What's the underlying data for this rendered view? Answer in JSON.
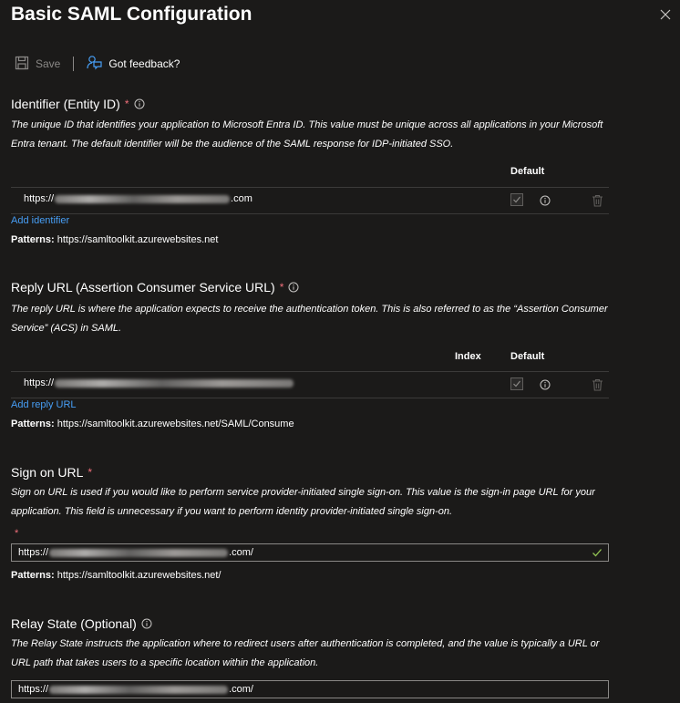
{
  "header": {
    "title": "Basic SAML Configuration"
  },
  "toolbar": {
    "save_label": "Save",
    "feedback_label": "Got feedback?"
  },
  "identifier": {
    "title": "Identifier (Entity ID)",
    "required_marker": "*",
    "description": "The unique ID that identifies your application to Microsoft Entra ID. This value must be unique across all applications in your Microsoft Entra tenant. The default identifier will be the audience of the SAML response for IDP-initiated SSO.",
    "col_default": "Default",
    "rows": [
      {
        "url_prefix": "https://",
        "url_suffix": ".com",
        "default_checked": true
      }
    ],
    "add_link": "Add identifier",
    "patterns_label": "Patterns:",
    "patterns_value": " https://samltoolkit.azurewebsites.net"
  },
  "reply_url": {
    "title": "Reply URL (Assertion Consumer Service URL)",
    "required_marker": "*",
    "description": "The reply URL is where the application expects to receive the authentication token. This is also referred to as the “Assertion Consumer Service” (ACS) in SAML.",
    "col_index": "Index",
    "col_default": "Default",
    "rows": [
      {
        "url_prefix": "https://",
        "url_suffix": "",
        "default_checked": true
      }
    ],
    "add_link": "Add reply URL",
    "patterns_label": "Patterns:",
    "patterns_value": " https://samltoolkit.azurewebsites.net/SAML/Consume"
  },
  "sign_on": {
    "title": "Sign on URL",
    "required_marker": "*",
    "description": "Sign on URL is used if you would like to perform service provider-initiated single sign-on. This value is the sign-in page URL for your application. This field is unnecessary if you want to perform identity provider-initiated single sign-on.",
    "field_marker": "*",
    "value_prefix": "https://",
    "value_suffix": ".com/",
    "patterns_label": "Patterns:",
    "patterns_value": " https://samltoolkit.azurewebsites.net/"
  },
  "relay_state": {
    "title": "Relay State (Optional)",
    "description": "The Relay State instructs the application where to redirect users after authentication is completed, and the value is typically a URL or URL path that takes users to a specific location within the application.",
    "value_prefix": "https://",
    "value_suffix": ".com/"
  },
  "colors": {
    "background": "#1b1a19",
    "link": "#479ef5",
    "required": "#f1707b",
    "valid_check": "#92c353"
  }
}
